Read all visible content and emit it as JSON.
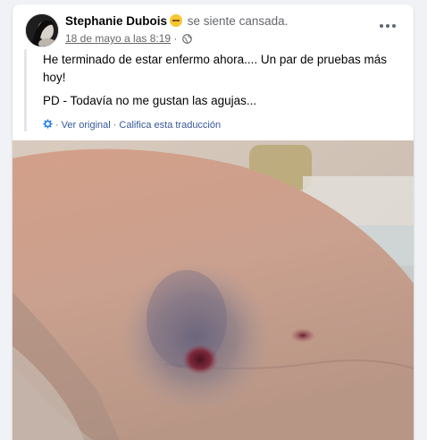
{
  "post": {
    "author": "Stephanie Dubois",
    "feeling": "se siente cansada.",
    "feeling_emoji": "sleepy-face-icon",
    "date": "18 de mayo a las 8:19",
    "separator": "·",
    "privacy_icon": "globe-icon",
    "more_icon": "more-options-icon",
    "text_line1": "He terminado de estar enfermo ahora.... Un par de pruebas más hoy!",
    "text_line2": "PD - Todavía no me gustan las agujas...",
    "translation": {
      "view_original": "Ver original",
      "separator": "·",
      "rate": "Califica esta traducción"
    },
    "photo_icon": "photo-arm-bruise"
  },
  "colors": {
    "background": "#f0f2f5",
    "card": "#ffffff",
    "link": "#385898",
    "muted": "#65676b"
  }
}
